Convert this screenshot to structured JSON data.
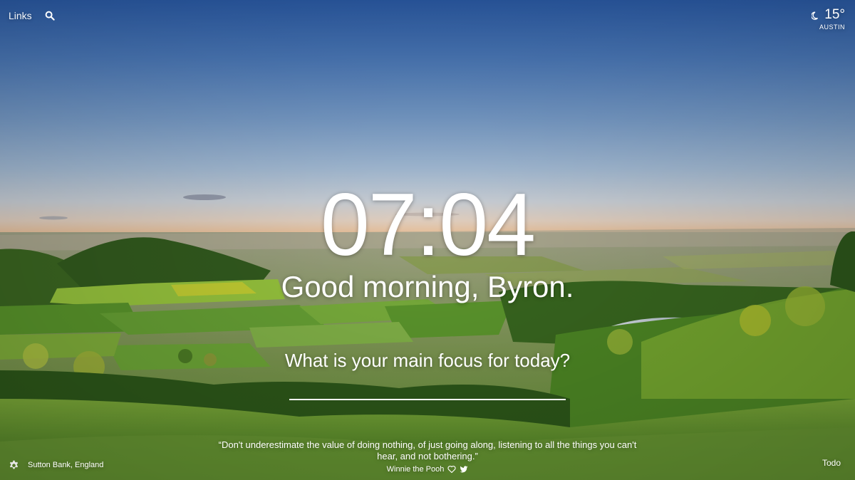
{
  "nav": {
    "links_label": "Links",
    "search_icon": "search-icon"
  },
  "weather": {
    "icon": "moon-icon",
    "temperature": "15°",
    "city": "AUSTIN"
  },
  "clock": {
    "time": "07:04"
  },
  "greeting": {
    "text": "Good morning, Byron."
  },
  "focus": {
    "question": "What is your main focus for today?",
    "input_value": ""
  },
  "quote": {
    "text": "“Don't underestimate the value of doing nothing, of just going along, listening to all the things you can't hear, and not bothering.”",
    "author": "Winnie the Pooh"
  },
  "footer": {
    "settings_icon": "gear-icon",
    "location": "Sutton Bank, England",
    "todo_label": "Todo"
  },
  "colors": {
    "sky_top": "#2e62b3",
    "horizon": "#f2c9a2",
    "grass": "#6fa13a",
    "text": "#ffffff"
  }
}
